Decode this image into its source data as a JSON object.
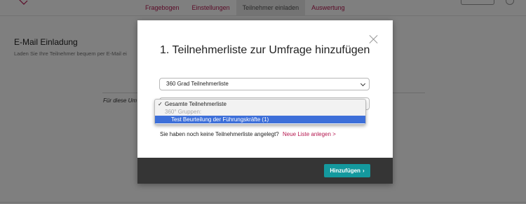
{
  "nav": {
    "tabs": [
      {
        "label": "Fragebogen",
        "active": false
      },
      {
        "label": "Einstellungen",
        "active": false
      },
      {
        "label": "Teilnehmer einladen",
        "active": true
      },
      {
        "label": "Auswertung",
        "active": false
      }
    ]
  },
  "page": {
    "section_title": "E-Mail Einladung",
    "section_subtitle": "Laden Sie Ihre Teilnehmer bequem per E-Mail ei",
    "italic_label": "Für diese Um"
  },
  "modal": {
    "title": "1. Teilnehmerliste zur Umfrage hinzufügen",
    "select1_value": "360 Grad Teilnehmerliste",
    "dropdown": {
      "selected_option": "Gesamte Teilnehmerliste",
      "group_label": "360° Gruppen:",
      "highlighted_option": "Test Beurteilung der Führungskräfte (1)"
    },
    "hint_text": "Sie haben noch keine Teilnehmerliste angelegt?",
    "hint_link": "Neue Liste anlegen >",
    "add_button": "Hinzufügen",
    "add_button_arrow": "›"
  },
  "colors": {
    "accent_link": "#b5174f",
    "button_teal": "#14999e",
    "footer_dark": "#353535",
    "highlight_blue": "#3d6fd9"
  }
}
